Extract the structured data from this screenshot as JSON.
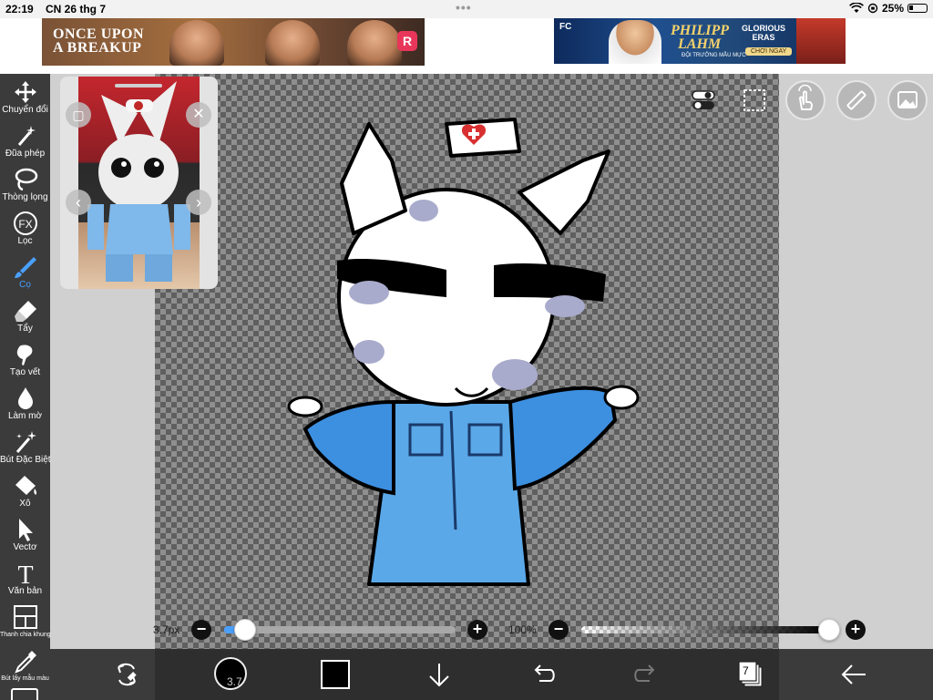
{
  "status": {
    "time": "22:19",
    "date": "CN 26 thg 7",
    "battery": "25%"
  },
  "ads": {
    "left": {
      "title_line1": "ONCE UPON",
      "title_line2": "A BREAKUP",
      "logo": "R"
    },
    "right": {
      "brand": "FC",
      "name_line1": "PHILIPP",
      "name_line2": "LAHM",
      "subtitle": "ĐỘI TRƯỞNG MẪU MỰC",
      "glory_line1": "GLORIOUS",
      "glory_line2": "ERAS",
      "cta": "CHƠI NGAY"
    }
  },
  "tools": [
    {
      "label": "Chuyển đổi",
      "icon": "move-icon"
    },
    {
      "label": "Đũa phép",
      "icon": "magic-wand-icon"
    },
    {
      "label": "Thòng lọng",
      "icon": "lasso-icon"
    },
    {
      "label": "Lọc",
      "icon": "fx-icon"
    },
    {
      "label": "Cọ",
      "icon": "brush-icon",
      "active": true
    },
    {
      "label": "Tẩy",
      "icon": "eraser-icon"
    },
    {
      "label": "Tạo vết",
      "icon": "smudge-icon"
    },
    {
      "label": "Làm mờ",
      "icon": "blur-icon"
    },
    {
      "label": "Bút Đặc Biệt",
      "icon": "special-pen-icon"
    },
    {
      "label": "Xô",
      "icon": "bucket-icon"
    },
    {
      "label": "Vectơ",
      "icon": "vector-icon"
    },
    {
      "label": "Văn bản",
      "icon": "text-icon"
    },
    {
      "label": "Thanh chia khung",
      "icon": "frame-divider-icon"
    },
    {
      "label": "Bút lấy mẫu màu",
      "icon": "eyedropper-icon"
    }
  ],
  "brush": {
    "size_label": "3.7px",
    "size_value": "3.7",
    "opacity_label": "100%",
    "size_fraction": 0.09,
    "opacity_fraction": 1.0
  },
  "layers": {
    "count": "7"
  },
  "colors": {
    "accent": "#4aa0ff",
    "current_color": "#000000",
    "toolbar": "#3b3b3b"
  }
}
